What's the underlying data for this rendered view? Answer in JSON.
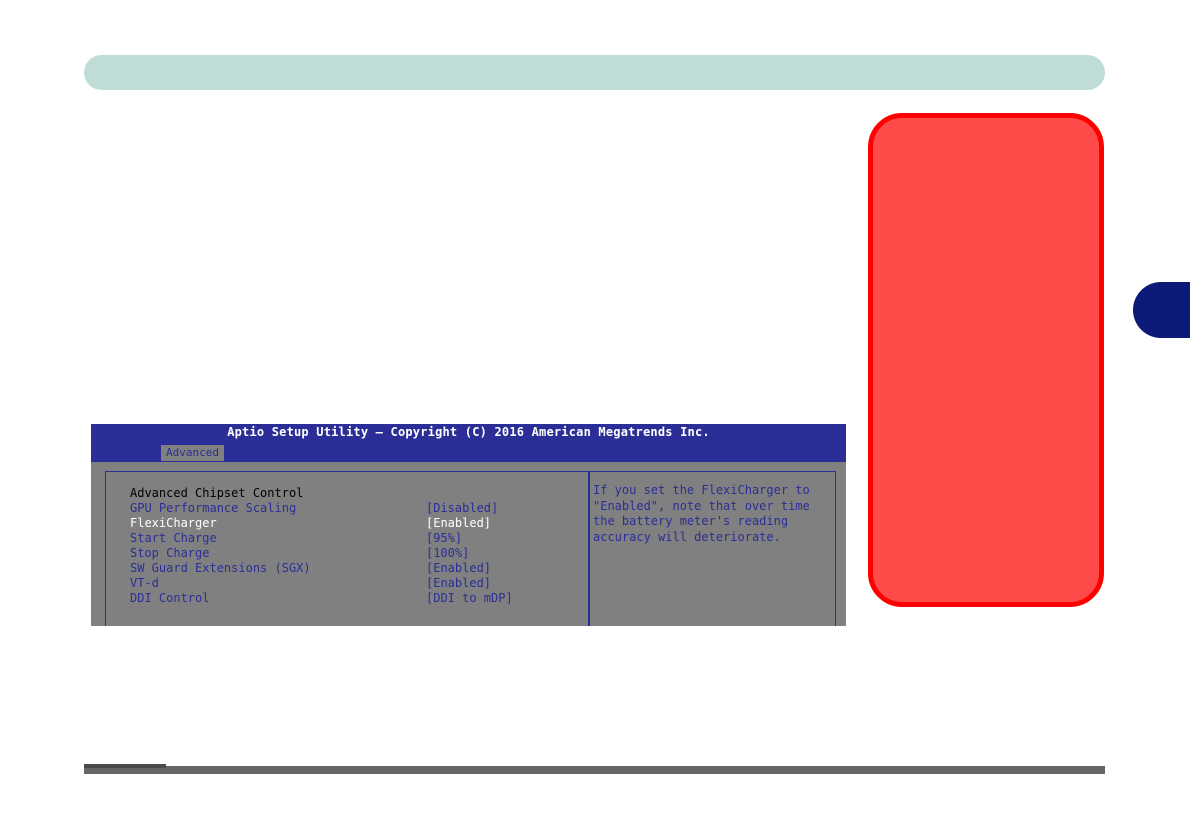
{
  "bios": {
    "title": "Aptio Setup Utility – Copyright (C) 2016 American Megatrends Inc.",
    "active_tab": "Advanced",
    "heading": "Advanced Chipset Control",
    "items": [
      {
        "label": "GPU Performance Scaling",
        "value": "[Disabled]"
      },
      {
        "label": "FlexiCharger",
        "value": "[Enabled]"
      },
      {
        "label": "Start Charge",
        "value": "[95%]"
      },
      {
        "label": "Stop Charge",
        "value": "[100%]"
      },
      {
        "label": "SW Guard Extensions (SGX)",
        "value": "[Enabled]"
      },
      {
        "label": "VT-d",
        "value": "[Enabled]"
      },
      {
        "label": "DDI Control",
        "value": "[DDI to mDP]"
      }
    ],
    "selected_item": "FlexiCharger",
    "help_text": "If you set the FlexiCharger to \"Enabled\", note that over time the battery meter's reading accuracy will deteriorate.",
    "colors": {
      "title_bar": "#2b2e96",
      "background": "#808080",
      "text": "#2b2e96",
      "selected_text": "#ffffff"
    }
  },
  "page_colors": {
    "header_bar": "#c0dcd6",
    "chapter_tab": "#0c1a78",
    "note_box_fill": "#ff4a4a",
    "note_box_border": "#ff0000"
  }
}
